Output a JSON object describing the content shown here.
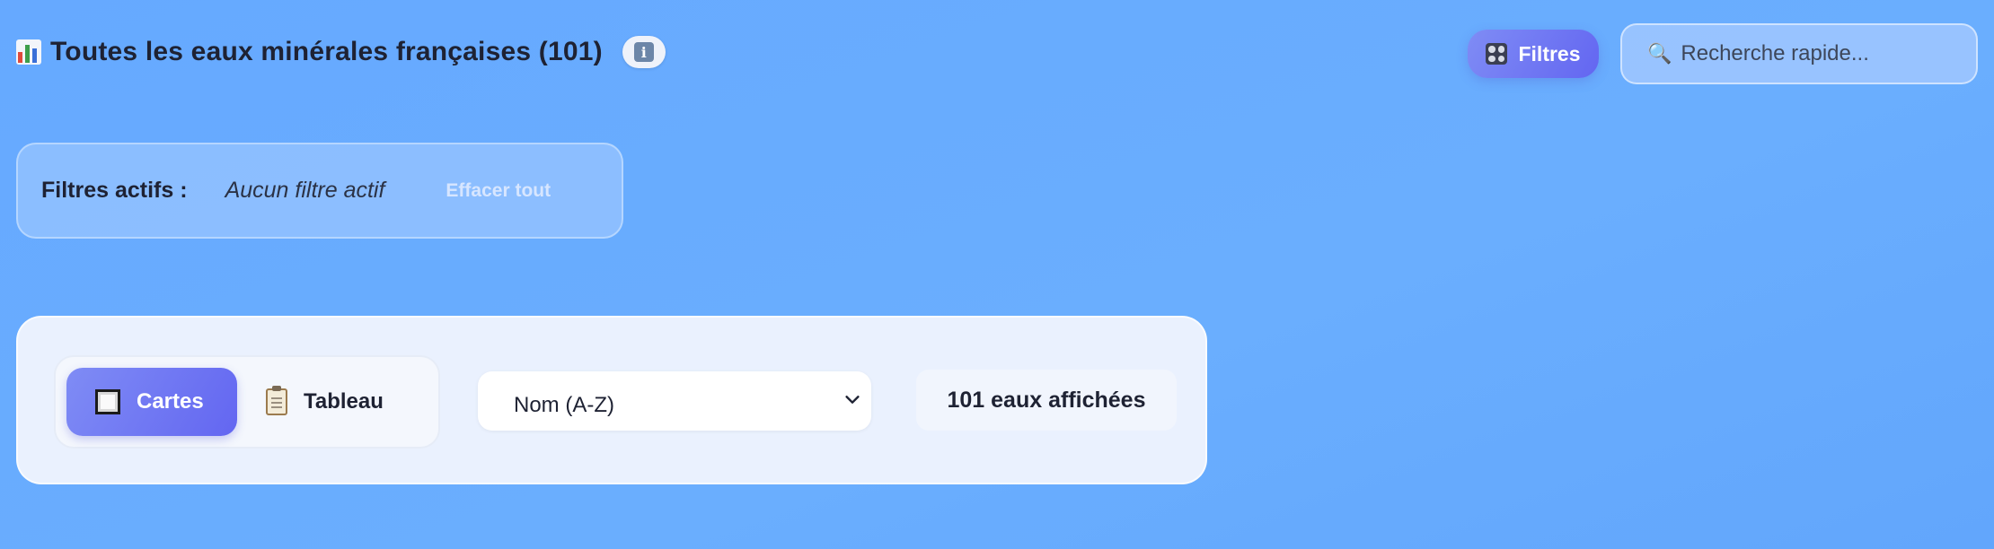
{
  "header": {
    "title": "Toutes les eaux minérales françaises (101)",
    "title_icon": "bar-chart-icon",
    "info_icon": "info-icon"
  },
  "filters_button": {
    "label": "Filtres",
    "icon": "control-knobs-icon"
  },
  "search": {
    "placeholder": "Recherche rapide...",
    "value": "",
    "icon": "magnifier-icon"
  },
  "active_filters": {
    "label": "Filtres actifs :",
    "none_text": "Aucun filtre actif",
    "clear_label": "Effacer tout"
  },
  "view_toggle": {
    "cards_label": "Cartes",
    "cards_icon": "square-icon",
    "table_label": "Tableau",
    "table_icon": "clipboard-icon",
    "selected": "Cartes"
  },
  "sort": {
    "selected": "Nom (A-Z)"
  },
  "count_text": "101 eaux affichées",
  "colors": {
    "background": "#66a9ff",
    "accent": "#6366f1",
    "text": "#1e2233"
  }
}
